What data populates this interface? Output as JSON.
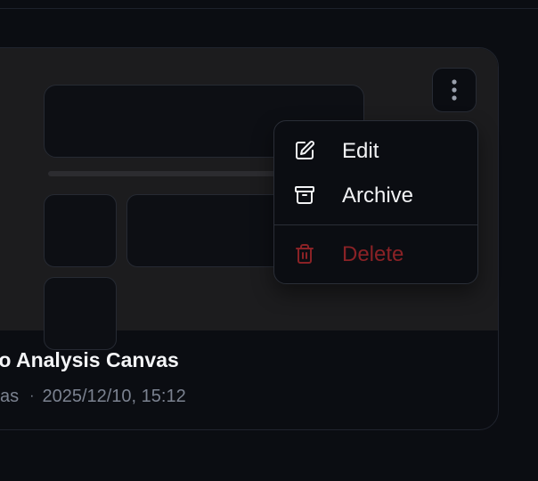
{
  "card": {
    "title": "io Analysis Canvas",
    "type_label": "vas",
    "separator": "·",
    "timestamp": "2025/12/10, 15:12"
  },
  "more_button": {
    "icon": "more-vertical-icon"
  },
  "menu": {
    "items": [
      {
        "label": "Edit",
        "icon": "pencil-icon"
      },
      {
        "label": "Archive",
        "icon": "archive-icon"
      },
      {
        "label": "Delete",
        "icon": "trash-icon"
      }
    ]
  },
  "colors": {
    "background": "#0b0d12",
    "preview": "#1c1c1e",
    "text": "#f2f3f5",
    "muted": "#7b8290",
    "danger": "#8a2226"
  }
}
